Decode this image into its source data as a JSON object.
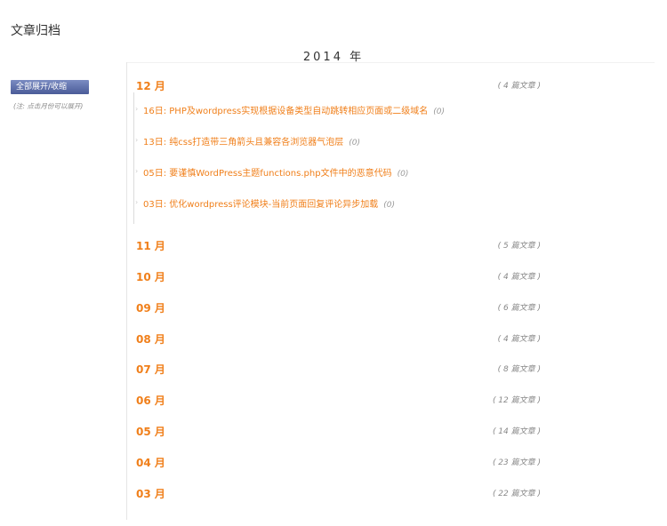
{
  "page": {
    "title": "文章归档"
  },
  "archive": {
    "year": "2014 年",
    "toggle_all_label": "全部展开/收缩",
    "toggle_hint": "(注: 点击月份可以展开)",
    "months": [
      {
        "label": "12 月",
        "count": "( 4 篇文章 )",
        "posts": [
          {
            "title": "16日: PHP及wordpress实现根据设备类型自动跳转相应页面或二级域名",
            "comments": "(0)"
          },
          {
            "title": "13日: 纯css打造带三角箭头且兼容各浏览器气泡层",
            "comments": "(0)"
          },
          {
            "title": "05日: 要谨慎WordPress主题functions.php文件中的恶意代码",
            "comments": "(0)"
          },
          {
            "title": "03日: 优化wordpress评论模块-当前页面回复评论异步加载",
            "comments": "(0)"
          }
        ]
      },
      {
        "label": "11 月",
        "count": "( 5 篇文章 )"
      },
      {
        "label": "10 月",
        "count": "( 4 篇文章 )"
      },
      {
        "label": "09 月",
        "count": "( 6 篇文章 )"
      },
      {
        "label": "08 月",
        "count": "( 4 篇文章 )"
      },
      {
        "label": "07 月",
        "count": "( 8 篇文章 )"
      },
      {
        "label": "06 月",
        "count": "( 12 篇文章 )"
      },
      {
        "label": "05 月",
        "count": "( 14 篇文章 )"
      },
      {
        "label": "04 月",
        "count": "( 23 篇文章 )"
      },
      {
        "label": "03 月",
        "count": "( 22 篇文章 )"
      }
    ]
  },
  "colors": {
    "accent": "#f07f1a",
    "button": "#5a6ba8",
    "muted": "#888888"
  }
}
